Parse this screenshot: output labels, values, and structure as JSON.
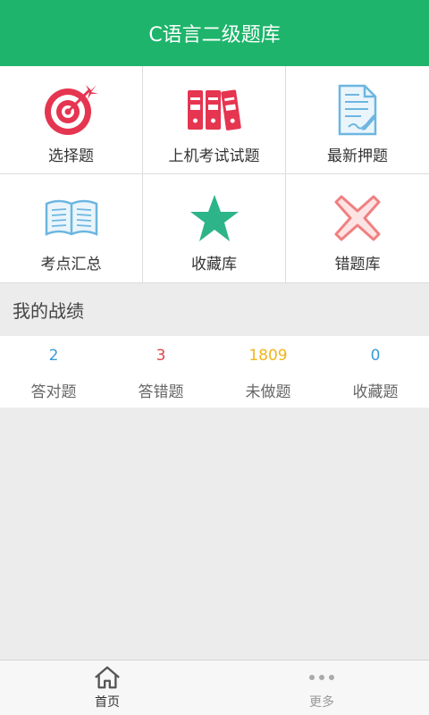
{
  "header": {
    "title": "C语言二级题库"
  },
  "grid": {
    "items": [
      {
        "label": "选择题",
        "icon": "target-icon"
      },
      {
        "label": "上机考试试题",
        "icon": "binders-icon"
      },
      {
        "label": "最新押题",
        "icon": "document-pen-icon"
      },
      {
        "label": "考点汇总",
        "icon": "open-book-icon"
      },
      {
        "label": "收藏库",
        "icon": "star-icon"
      },
      {
        "label": "错题库",
        "icon": "x-mark-icon"
      }
    ]
  },
  "section": {
    "title": "我的战绩"
  },
  "stats": [
    {
      "value": "2",
      "label": "答对题",
      "color": "#3a9ad9"
    },
    {
      "value": "3",
      "label": "答错题",
      "color": "#e2434b"
    },
    {
      "value": "1809",
      "label": "未做题",
      "color": "#f2b51a"
    },
    {
      "value": "0",
      "label": "收藏题",
      "color": "#3a9ad9"
    }
  ],
  "tabbar": {
    "items": [
      {
        "label": "首页",
        "icon": "home-icon",
        "active": true
      },
      {
        "label": "更多",
        "icon": "more-dots-icon",
        "active": false
      }
    ]
  },
  "colors": {
    "brand": "#1eb46b",
    "target": "#e53550",
    "star": "#2db489",
    "x": "#f08080",
    "book": "#6cb6e0"
  }
}
